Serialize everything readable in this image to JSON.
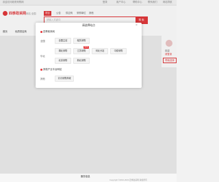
{
  "topbar": {
    "left_text": "欢迎访问政府采购网",
    "right_links": [
      "登录",
      "用户中心",
      "帮助中心",
      "联系我们",
      "网站导航"
    ]
  },
  "header": {
    "logo": "四季政采网",
    "region": "网站 全国",
    "search_tabs": [
      "项目",
      "公告",
      "供应商",
      "采购单位",
      "其他"
    ],
    "search_placeholder": "请输入关键词",
    "search_button": "搜 索"
  },
  "nav": {
    "items": [
      "首页",
      "优质供应商"
    ]
  },
  "right_panel": {
    "welcome": "欢迎",
    "login_label": "请登录",
    "register_button": "帮我选择"
  },
  "modal": {
    "title": "请选择站点",
    "close": "×",
    "section1": "四季政采网",
    "row1_label": "全国",
    "row1_chips": [
      "全国主站",
      "租赁采购"
    ],
    "row2_label": "华北",
    "row2_chips": [
      "湖北采购",
      "江苏采购",
      "河北分站",
      "中原采购"
    ],
    "row2_badge": "NEW",
    "row3_chips": [
      "北京采购",
      "新北采购"
    ],
    "section2": "其他产业平台网站",
    "row4_label": "其他",
    "row4_chips": [
      "青青采购商城"
    ]
  },
  "footer": {
    "title": "服务信息",
    "copyright": "Copyright ©2010-2023 四季政采网 版权所有"
  }
}
